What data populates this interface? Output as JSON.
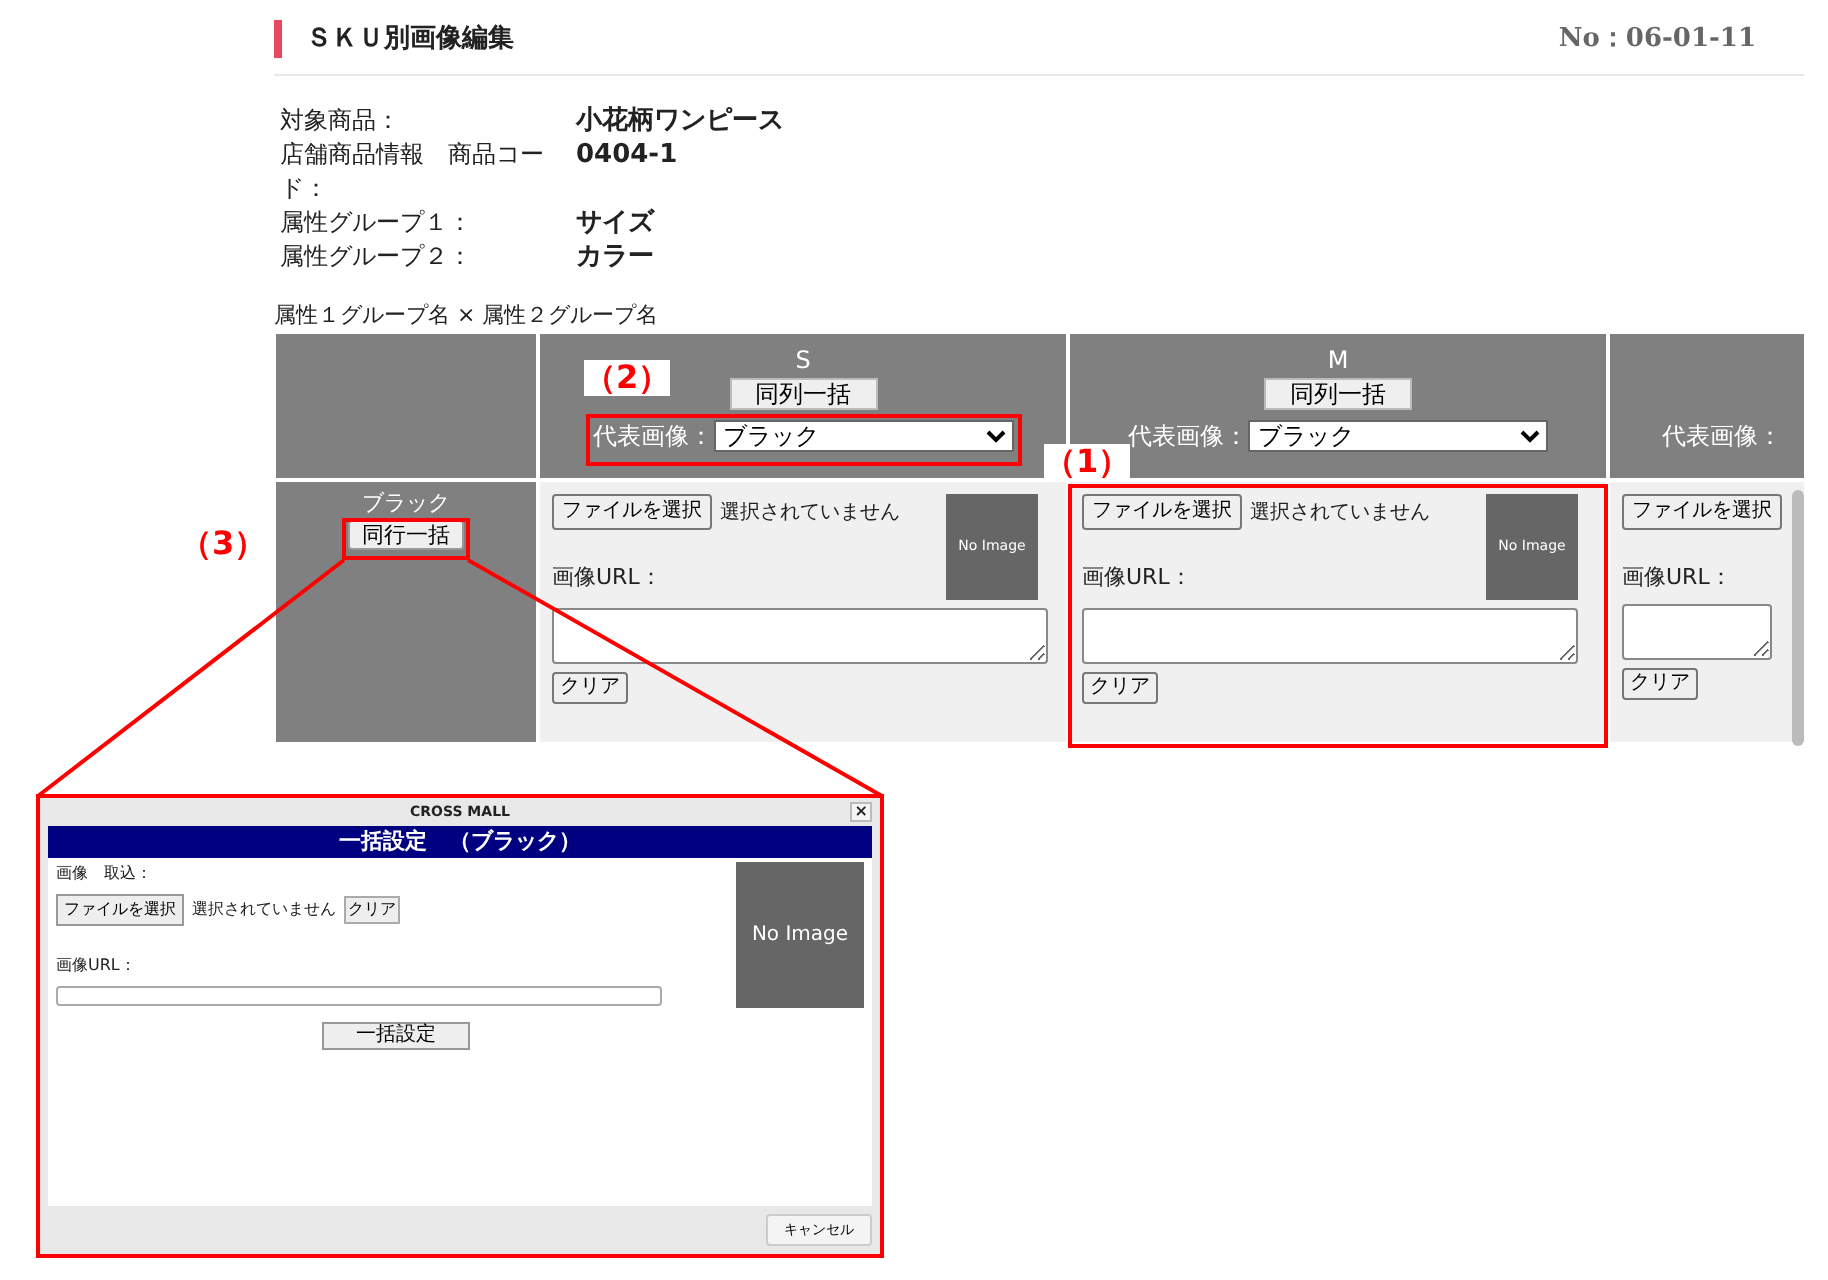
{
  "header": {
    "title": "ＳＫＵ別画像編集",
    "number": "No：06-01-11"
  },
  "info": [
    {
      "label": "対象商品：",
      "value": "小花柄ワンピース"
    },
    {
      "label": "店舗商品情報　商品コード：",
      "value": "0404-1"
    },
    {
      "label": "属性グループ１：",
      "value": "サイズ"
    },
    {
      "label": "属性グループ２：",
      "value": "カラー"
    }
  ],
  "matrix": {
    "caption": "属性１グループ名 × 属性２グループ名",
    "columns": [
      {
        "label": "S",
        "column_button": "同列一括",
        "rep_label": "代表画像：",
        "rep_value": "ブラック"
      },
      {
        "label": "M",
        "column_button": "同列一括",
        "rep_label": "代表画像：",
        "rep_value": "ブラック"
      },
      {
        "rep_label": "代表画像："
      }
    ],
    "rows": [
      {
        "label": "ブラック",
        "row_button": "同行一括",
        "cells": [
          {
            "file_button": "ファイルを選択",
            "file_status": "選択されていません",
            "image_placeholder": "No Image",
            "url_label": "画像URL：",
            "clear_button": "クリア"
          },
          {
            "file_button": "ファイルを選択",
            "file_status": "選択されていません",
            "image_placeholder": "No Image",
            "url_label": "画像URL：",
            "clear_button": "クリア"
          },
          {
            "file_button": "ファイルを選択",
            "url_label": "画像URL：",
            "clear_button": "クリア"
          }
        ]
      }
    ]
  },
  "annotations": [
    {
      "label": "（1）"
    },
    {
      "label": "（2）"
    },
    {
      "label": "（3）"
    }
  ],
  "dialog": {
    "window_title": "CROSS MALL",
    "close": "×",
    "heading": "一括設定　（ブラック）",
    "image_label": "画像　取込：",
    "file_button": "ファイルを選択",
    "file_status": "選択されていません",
    "clear_button": "クリア",
    "url_label": "画像URL：",
    "image_placeholder": "No Image",
    "apply_button": "一括設定",
    "cancel_button": "キャンセル"
  }
}
